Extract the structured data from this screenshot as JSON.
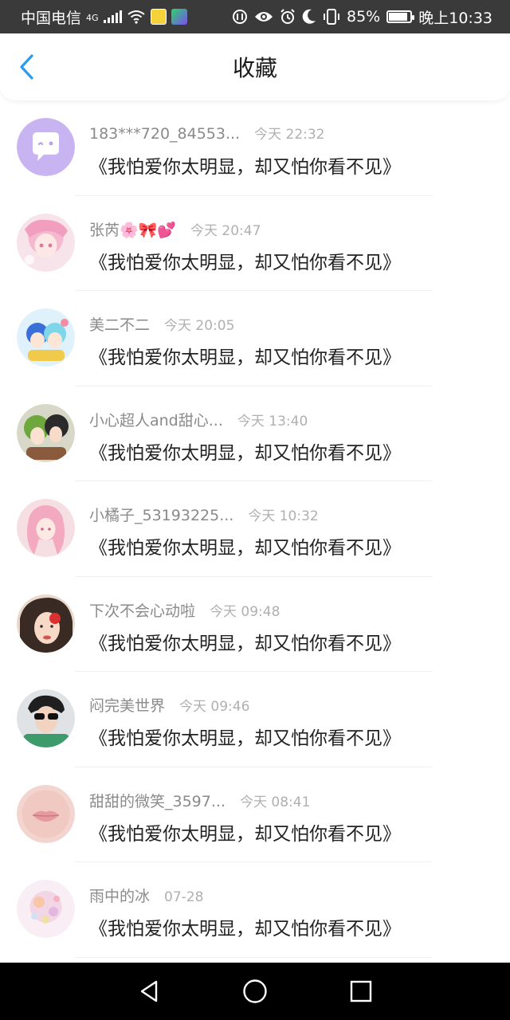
{
  "status_bar": {
    "carrier": "中国电信",
    "network": "4G",
    "battery": "85%",
    "time": "晚上10:33"
  },
  "header": {
    "title": "收藏",
    "back_icon": "chevron-left-icon"
  },
  "items": [
    {
      "username": "183***720_84553...",
      "time": "今天 22:32",
      "content": "《我怕爱你太明显，却又怕你看不见》",
      "avatar": "default-chat-avatar"
    },
    {
      "username": "张芮🌸🎀💕",
      "time": "今天 20:47",
      "content": "《我怕爱你太明显，却又怕你看不见》",
      "avatar": "anime-pink-avatar"
    },
    {
      "username": "美二不二",
      "time": "今天 20:05",
      "content": "《我怕爱你太明显，却又怕你看不见》",
      "avatar": "anime-blue-avatar"
    },
    {
      "username": "小心超人and甜心...",
      "time": "今天 13:40",
      "content": "《我怕爱你太明显，却又怕你看不见》",
      "avatar": "anime-couple-avatar"
    },
    {
      "username": "小橘子_53193225...",
      "time": "今天 10:32",
      "content": "《我怕爱你太明显，却又怕你看不见》",
      "avatar": "anime-girl-avatar"
    },
    {
      "username": "下次不会心动啦",
      "time": "今天 09:48",
      "content": "《我怕爱你太明显，却又怕你看不见》",
      "avatar": "illustrated-girl-avatar"
    },
    {
      "username": "闷完美世界",
      "time": "今天 09:46",
      "content": "《我怕爱你太明显，却又怕你看不见》",
      "avatar": "photo-boy-avatar"
    },
    {
      "username": "甜甜的微笑_3597...",
      "time": "今天 08:41",
      "content": "《我怕爱你太明显，却又怕你看不见》",
      "avatar": "lips-photo-avatar"
    },
    {
      "username": "雨中的冰",
      "time": "07-28",
      "content": "《我怕爱你太明显，却又怕你看不见》",
      "avatar": "pastel-art-avatar"
    }
  ],
  "colors": {
    "accent": "#2a9bf0",
    "status_bar_bg": "#3a3a3a",
    "nav_bar_bg": "#000000"
  }
}
